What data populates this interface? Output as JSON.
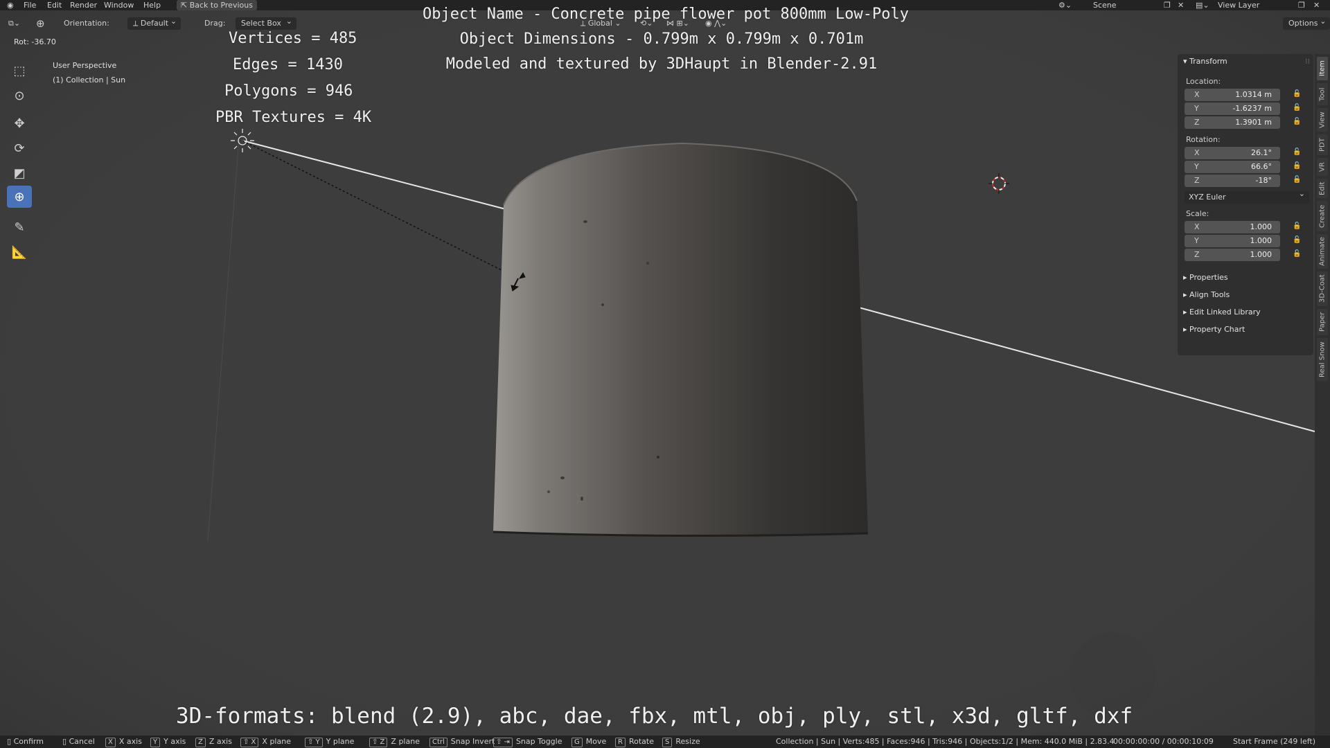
{
  "menu": {
    "items": [
      "File",
      "Edit",
      "Render",
      "Window",
      "Help"
    ],
    "back_button": "Back to Previous",
    "scene": "Scene",
    "view_layer": "View Layer"
  },
  "header": {
    "orientation_label": "Orientation:",
    "orientation_value": "Default",
    "drag_label": "Drag:",
    "drag_value": "Select Box",
    "transform_orientation": "Global",
    "options": "Options"
  },
  "viewport": {
    "rot": "Rot: -36.70",
    "perspective": "User Perspective",
    "collection": "(1) Collection | Sun"
  },
  "overlay": {
    "stats": [
      "Vertices = 485",
      "Edges = 1430",
      "Polygons = 946",
      "PBR Textures = 4K"
    ],
    "info": [
      "Object Name - Concrete pipe flower pot 800mm Low-Poly",
      "Object Dimensions -  0.799m x 0.799m x 0.701m",
      "Modeled and textured by 3DHaupt in Blender-2.91"
    ],
    "formats": "3D-formats: blend (2.9), abc, dae, fbx, mtl, obj, ply, stl, x3d, gltf, dxf"
  },
  "panel": {
    "transform_title": "Transform",
    "location_label": "Location:",
    "location": [
      {
        "axis": "X",
        "value": "1.0314 m"
      },
      {
        "axis": "Y",
        "value": "-1.6237 m"
      },
      {
        "axis": "Z",
        "value": "1.3901 m"
      }
    ],
    "rotation_label": "Rotation:",
    "rotation": [
      {
        "axis": "X",
        "value": "26.1°"
      },
      {
        "axis": "Y",
        "value": "66.6°"
      },
      {
        "axis": "Z",
        "value": "-18°"
      }
    ],
    "rotation_mode": "XYZ Euler",
    "scale_label": "Scale:",
    "scale": [
      {
        "axis": "X",
        "value": "1.000"
      },
      {
        "axis": "Y",
        "value": "1.000"
      },
      {
        "axis": "Z",
        "value": "1.000"
      }
    ],
    "sections": [
      "Properties",
      "Align Tools",
      "Edit Linked Library",
      "Property Chart"
    ]
  },
  "tabs": [
    "Item",
    "Tool",
    "View",
    "PDT",
    "VR",
    "Edit",
    "Create",
    "Animate",
    "3D-Coat",
    "Paper",
    "Real Snow"
  ],
  "status": {
    "confirm": "Confirm",
    "cancel": "Cancel",
    "keys": [
      {
        "key": "X",
        "label": "X axis"
      },
      {
        "key": "Y",
        "label": "Y axis"
      },
      {
        "key": "Z",
        "label": "Z axis"
      },
      {
        "key": "⇧ X",
        "label": "X plane"
      },
      {
        "key": "⇧ Y",
        "label": "Y plane"
      },
      {
        "key": "⇧ Z",
        "label": "Z plane"
      },
      {
        "key": "Ctrl",
        "label": "Snap Invert"
      },
      {
        "key": "⇧ ⇥",
        "label": "Snap Toggle"
      },
      {
        "key": "G",
        "label": "Move"
      },
      {
        "key": "R",
        "label": "Rotate"
      },
      {
        "key": "S",
        "label": "Resize"
      }
    ],
    "info": "Collection | Sun | Verts:485 | Faces:946 | Tris:946 | Objects:1/2 | Mem: 440.0 MiB | 2.83.4",
    "time": "00:00:00:00 / 00:00:10:09",
    "frame": "Start Frame (249 left)"
  },
  "colors": {
    "background": "#3d3d3d",
    "active_tool": "#4a72b8",
    "panel": "#2f2f2f",
    "field": "#545454"
  }
}
